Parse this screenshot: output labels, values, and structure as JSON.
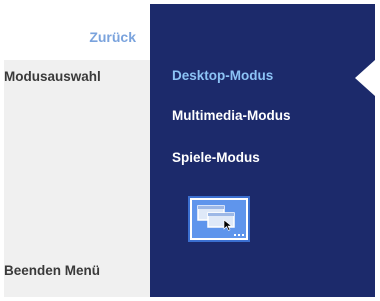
{
  "menu": {
    "back_label": "Zurück",
    "section_label": "Modusauswahl",
    "exit_label": "Beenden Menü"
  },
  "modes": {
    "items": [
      {
        "label": "Desktop-Modus",
        "selected": true
      },
      {
        "label": "Multimedia-Modus",
        "selected": false
      },
      {
        "label": "Spiele-Modus",
        "selected": false
      }
    ],
    "preview_icon": "desktop-mode-icon"
  },
  "colors": {
    "panel_dark": "#1c2a6b",
    "panel_light": "#f0f0f0",
    "accent": "#7aa3dd",
    "selected_text": "#8cc3f5"
  }
}
